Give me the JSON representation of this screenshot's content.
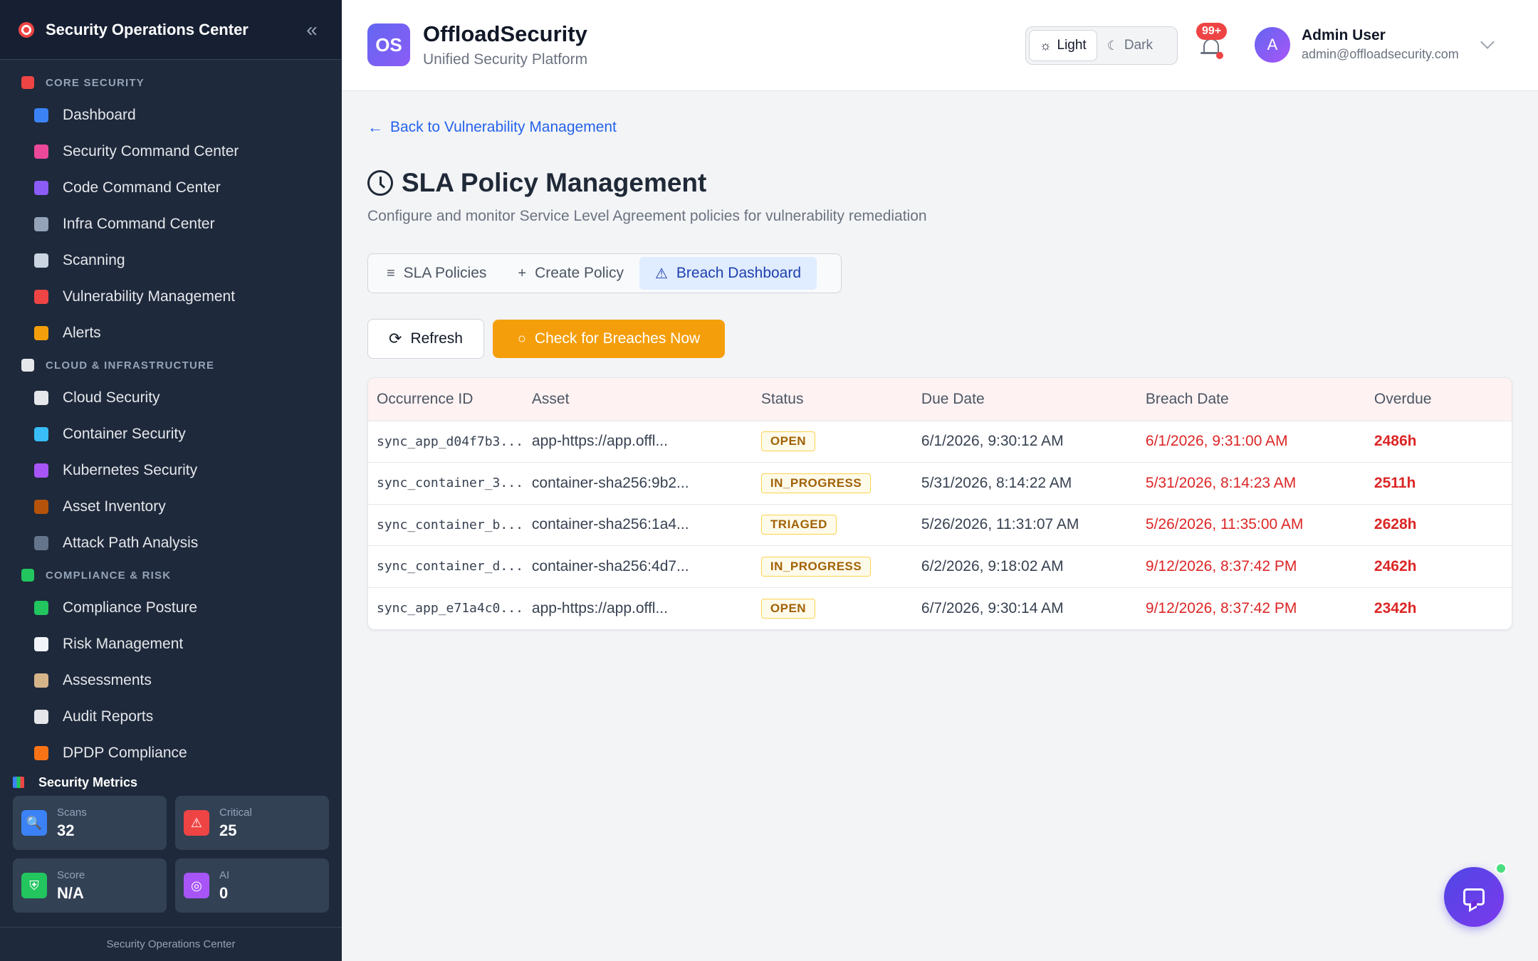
{
  "sidebar": {
    "title": "Security Operations Center",
    "collapse_icon": "«",
    "sections": [
      {
        "label": "CORE SECURITY",
        "color": "#ef4444",
        "items": [
          {
            "label": "Dashboard",
            "icon": "bar-chart-icon",
            "color": "#3b82f6"
          },
          {
            "label": "Security Command Center",
            "icon": "brain-icon",
            "color": "#ec4899"
          },
          {
            "label": "Code Command Center",
            "icon": "dna-icon",
            "color": "#8b5cf6"
          },
          {
            "label": "Infra Command Center",
            "icon": "monitor-icon",
            "color": "#94a3b8"
          },
          {
            "label": "Scanning",
            "icon": "magnifier-icon",
            "color": "#cbd5e1"
          },
          {
            "label": "Vulnerability Management",
            "icon": "shield-icon",
            "color": "#ef4444"
          },
          {
            "label": "Alerts",
            "icon": "bell-icon",
            "color": "#f59e0b"
          }
        ]
      },
      {
        "label": "CLOUD & INFRASTRUCTURE",
        "color": "#e5e7eb",
        "items": [
          {
            "label": "Cloud Security",
            "icon": "cloud-icon",
            "color": "#e5e7eb"
          },
          {
            "label": "Container Security",
            "icon": "whale-icon",
            "color": "#38bdf8"
          },
          {
            "label": "Kubernetes Security",
            "icon": "helm-icon",
            "color": "#a855f7"
          },
          {
            "label": "Asset Inventory",
            "icon": "package-icon",
            "color": "#b45309"
          },
          {
            "label": "Attack Path Analysis",
            "icon": "atom-icon",
            "color": "#64748b"
          }
        ]
      },
      {
        "label": "COMPLIANCE & RISK",
        "color": "#22c55e",
        "items": [
          {
            "label": "Compliance Posture",
            "icon": "check-box-icon",
            "color": "#22c55e"
          },
          {
            "label": "Risk Management",
            "icon": "trend-chart-icon",
            "color": "#f1f5f9"
          },
          {
            "label": "Assessments",
            "icon": "clipboard-icon",
            "color": "#d6b48a"
          },
          {
            "label": "Audit Reports",
            "icon": "document-icon",
            "color": "#e5e7eb"
          },
          {
            "label": "DPDP Compliance",
            "icon": "india-flag-icon",
            "color": "#f97316"
          }
        ]
      }
    ],
    "metrics": {
      "title": "Security Metrics",
      "cards": [
        {
          "label": "Scans",
          "value": "32",
          "icon": "magnifier-icon",
          "color": "#3b82f6",
          "glyph": "🔍"
        },
        {
          "label": "Critical",
          "value": "25",
          "icon": "warning-icon",
          "color": "#ef4444",
          "glyph": "⚠"
        },
        {
          "label": "Score",
          "value": "N/A",
          "icon": "shield-icon",
          "color": "#22c55e",
          "glyph": "⛨"
        },
        {
          "label": "AI",
          "value": "0",
          "icon": "robot-icon",
          "color": "#a855f7",
          "glyph": "◎"
        }
      ]
    },
    "footer": "Security Operations Center"
  },
  "header": {
    "logo_text": "OS",
    "brand_name": "OffloadSecurity",
    "brand_sub": "Unified Security Platform",
    "theme_light": "Light",
    "theme_dark": "Dark",
    "notif_badge": "99+",
    "avatar_letter": "A",
    "user_name": "Admin User",
    "user_email": "admin@offloadsecurity.com"
  },
  "main": {
    "back_link": "Back to Vulnerability Management",
    "title": "SLA Policy Management",
    "description": "Configure and monitor Service Level Agreement policies for vulnerability remediation",
    "tabs": [
      {
        "label": "SLA Policies",
        "icon": "filter-icon",
        "glyph": "≡"
      },
      {
        "label": "Create Policy",
        "icon": "plus-icon",
        "glyph": "+"
      },
      {
        "label": "Breach Dashboard",
        "icon": "warning-icon",
        "glyph": "⚠"
      }
    ],
    "refresh_label": "Refresh",
    "check_label": "Check for Breaches Now",
    "table": {
      "headers": [
        "Occurrence ID",
        "Asset",
        "Status",
        "Due Date",
        "Breach Date",
        "Overdue"
      ],
      "rows": [
        [
          "sync_app_d04f7b3...",
          "app-https://app.offl...",
          "OPEN",
          "6/1/2026, 9:30:12 AM",
          "6/1/2026, 9:31:00 AM",
          "2486h"
        ],
        [
          "sync_container_3...",
          "container-sha256:9b2...",
          "IN_PROGRESS",
          "5/31/2026, 8:14:22 AM",
          "5/31/2026, 8:14:23 AM",
          "2511h"
        ],
        [
          "sync_container_b...",
          "container-sha256:1a4...",
          "TRIAGED",
          "5/26/2026, 11:31:07 AM",
          "5/26/2026, 11:35:00 AM",
          "2628h"
        ],
        [
          "sync_container_d...",
          "container-sha256:4d7...",
          "IN_PROGRESS",
          "6/2/2026, 9:18:02 AM",
          "9/12/2026, 8:37:42 PM",
          "2462h"
        ],
        [
          "sync_app_e71a4c0...",
          "app-https://app.offl...",
          "OPEN",
          "6/7/2026, 9:30:14 AM",
          "9/12/2026, 8:37:42 PM",
          "2342h"
        ]
      ]
    }
  }
}
